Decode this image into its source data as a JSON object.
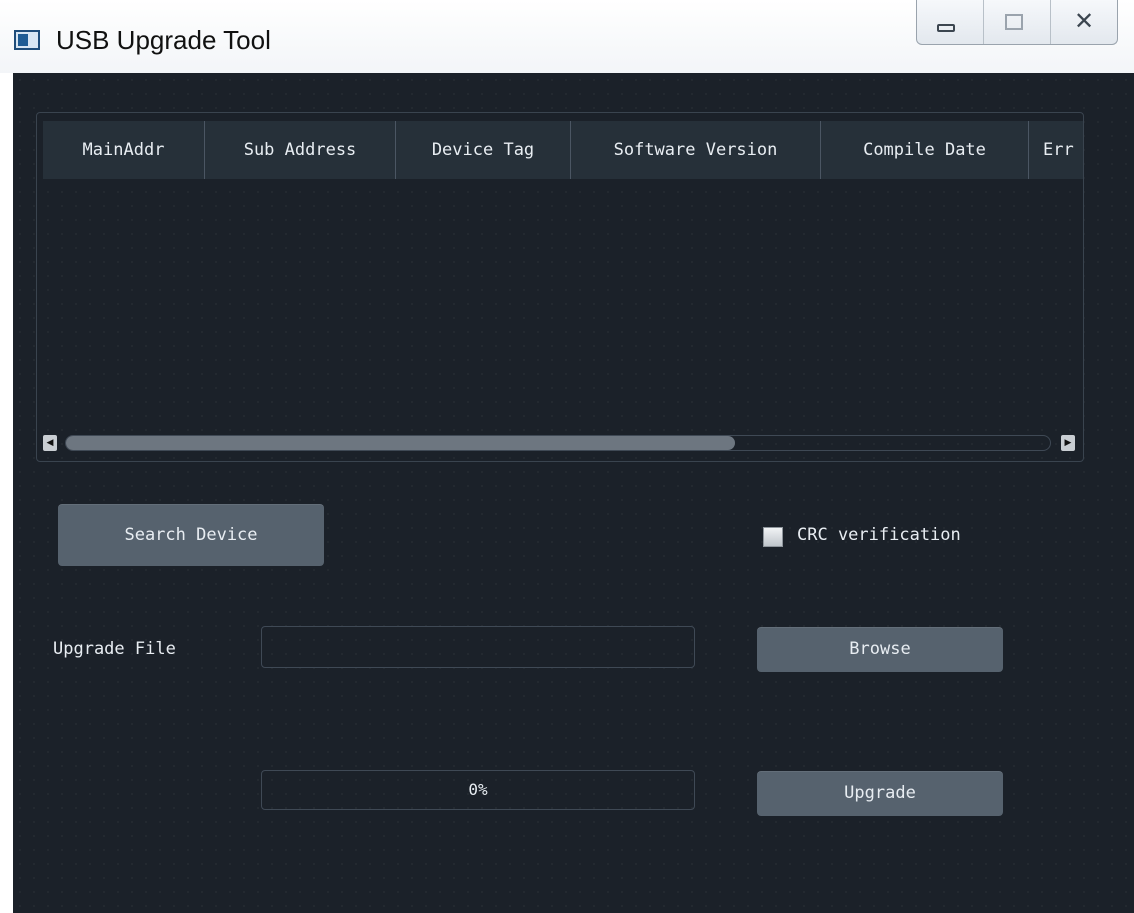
{
  "window": {
    "title": "USB Upgrade Tool"
  },
  "table": {
    "columns": [
      "MainAddr",
      "Sub Address",
      "Device Tag",
      "Software Version",
      "Compile Date",
      "Err"
    ],
    "rows": [],
    "scrollbar_position_fraction": 0.0,
    "scrollbar_visible_fraction": 0.68
  },
  "controls": {
    "search_device_label": "Search Device",
    "crc_label": "CRC verification",
    "crc_checked": false,
    "upgrade_file_label": "Upgrade File",
    "upgrade_file_value": "",
    "browse_label": "Browse",
    "upgrade_label": "Upgrade",
    "progress_text": "0%",
    "progress_fraction": 0.0
  },
  "colors": {
    "background": "#1b2129",
    "header_bg": "#263039",
    "button_bg": "#56626e",
    "text": "#e8edf2"
  }
}
